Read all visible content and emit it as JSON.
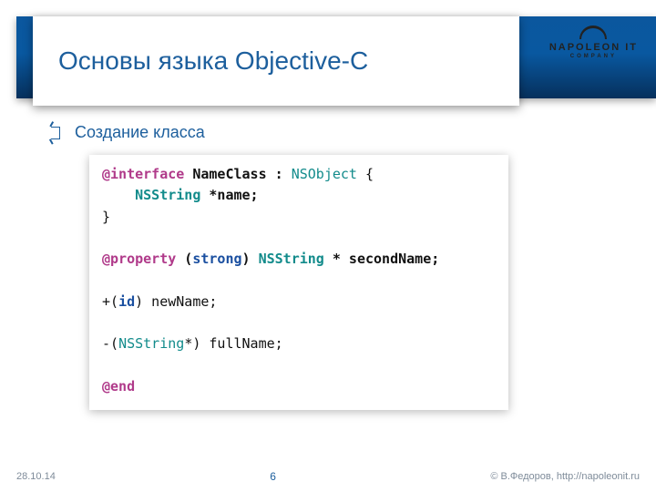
{
  "header": {
    "title": "Основы языка Objective-C"
  },
  "logo": {
    "line1": "NAPOLEON IT",
    "line2": "COMPANY"
  },
  "bullet": {
    "text": "Создание класса"
  },
  "code": {
    "l1a": "@interface",
    "l1b": " NameClass : ",
    "l1c": "NSObject",
    "l1d": " {",
    "l2a": "    ",
    "l2b": "NSString",
    "l2c": " *name;",
    "l3": "}",
    "blank": "",
    "l4a": "@property",
    "l4b": " (",
    "l4c": "strong",
    "l4d": ") ",
    "l4e": "NSString",
    "l4f": " * secondName;",
    "l5a": "+(",
    "l5b": "id",
    "l5c": ") newName;",
    "l6a": "-(",
    "l6b": "NSString",
    "l6c": "*) fullName;",
    "l7": "@end"
  },
  "footer": {
    "date": "28.10.14",
    "page": "6",
    "credit": "© В.Федоров, http://napoleonit.ru"
  }
}
